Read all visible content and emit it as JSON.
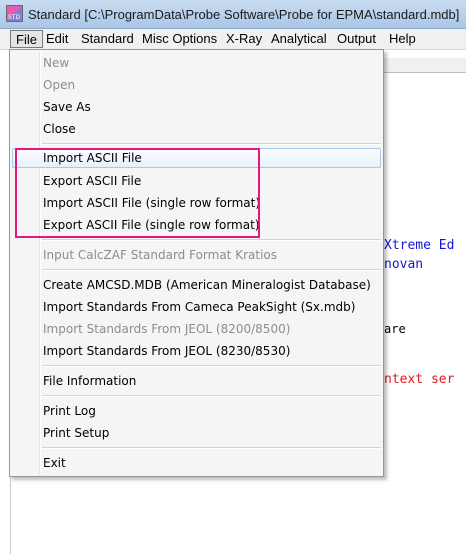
{
  "window": {
    "title": "Standard [C:\\ProgramData\\Probe Software\\Probe for EPMA\\standard.mdb]",
    "icon_label": "STD"
  },
  "menubar": [
    {
      "label": "File"
    },
    {
      "label": "Edit"
    },
    {
      "label": "Standard"
    },
    {
      "label": "Misc Options"
    },
    {
      "label": "X-Ray"
    },
    {
      "label": "Analytical"
    },
    {
      "label": "Output"
    },
    {
      "label": "Help"
    }
  ],
  "file_menu": {
    "group1": [
      {
        "label": "New",
        "enabled": false
      },
      {
        "label": "Open",
        "enabled": false
      },
      {
        "label": "Save As",
        "enabled": true
      },
      {
        "label": "Close",
        "enabled": true
      }
    ],
    "group2": [
      {
        "label": "Import ASCII File",
        "enabled": true
      },
      {
        "label": "Export ASCII File",
        "enabled": true
      },
      {
        "label": "Import ASCII File (single row format)",
        "enabled": true
      },
      {
        "label": "Export ASCII File (single row format)",
        "enabled": true
      }
    ],
    "group3": [
      {
        "label": "Input CalcZAF Standard Format Kratios",
        "enabled": false
      }
    ],
    "group4": [
      {
        "label": "Create AMCSD.MDB (American Mineralogist Database)",
        "enabled": true
      },
      {
        "label": "Import Standards From Cameca PeakSight (Sx.mdb)",
        "enabled": true
      },
      {
        "label": "Import Standards From JEOL (8200/8500)",
        "enabled": false
      },
      {
        "label": "Import Standards From JEOL (8230/8530)",
        "enabled": true
      }
    ],
    "group5": [
      {
        "label": "File Information",
        "enabled": true
      }
    ],
    "group6": [
      {
        "label": "Print Log",
        "enabled": true
      },
      {
        "label": "Print Setup",
        "enabled": true
      }
    ],
    "group7": [
      {
        "label": "Exit",
        "enabled": true
      }
    ]
  },
  "background_text": {
    "line1": "Xtreme Ed",
    "line2": "novan",
    "line3": "are",
    "line4": "ntext ser"
  },
  "colors": {
    "highlight_box": "#e2197c",
    "bg_text_blue": "#1515d6",
    "bg_text_red": "#e01b1b"
  }
}
